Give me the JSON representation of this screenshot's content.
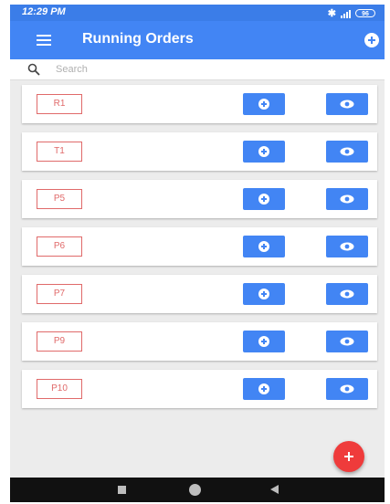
{
  "status_bar": {
    "time": "12:29 PM",
    "bluetooth_icon": "bluetooth-icon",
    "signal_icon": "signal-icon",
    "battery_label": "96",
    "background": "#3b7de8"
  },
  "app_bar": {
    "title": "Running Orders",
    "menu_icon": "hamburger-menu-icon",
    "action_icon": "plus-circle-icon",
    "background": "#4285f4"
  },
  "search": {
    "placeholder": "Search",
    "value": "",
    "icon": "search-icon"
  },
  "orders": [
    {
      "label": "R1"
    },
    {
      "label": "T1"
    },
    {
      "label": "P5"
    },
    {
      "label": "P6"
    },
    {
      "label": "P7"
    },
    {
      "label": "P9"
    },
    {
      "label": "P10"
    }
  ],
  "order_actions": {
    "add_icon": "plus-circle-icon",
    "view_icon": "eye-icon",
    "button_color": "#4285f4",
    "chip_color": "#e06a6a"
  },
  "fab": {
    "icon": "plus-icon",
    "color": "#ef3b3b"
  },
  "nav_bar": {
    "recent_icon": "square-icon",
    "home_icon": "circle-icon",
    "back_icon": "triangle-back-icon"
  }
}
